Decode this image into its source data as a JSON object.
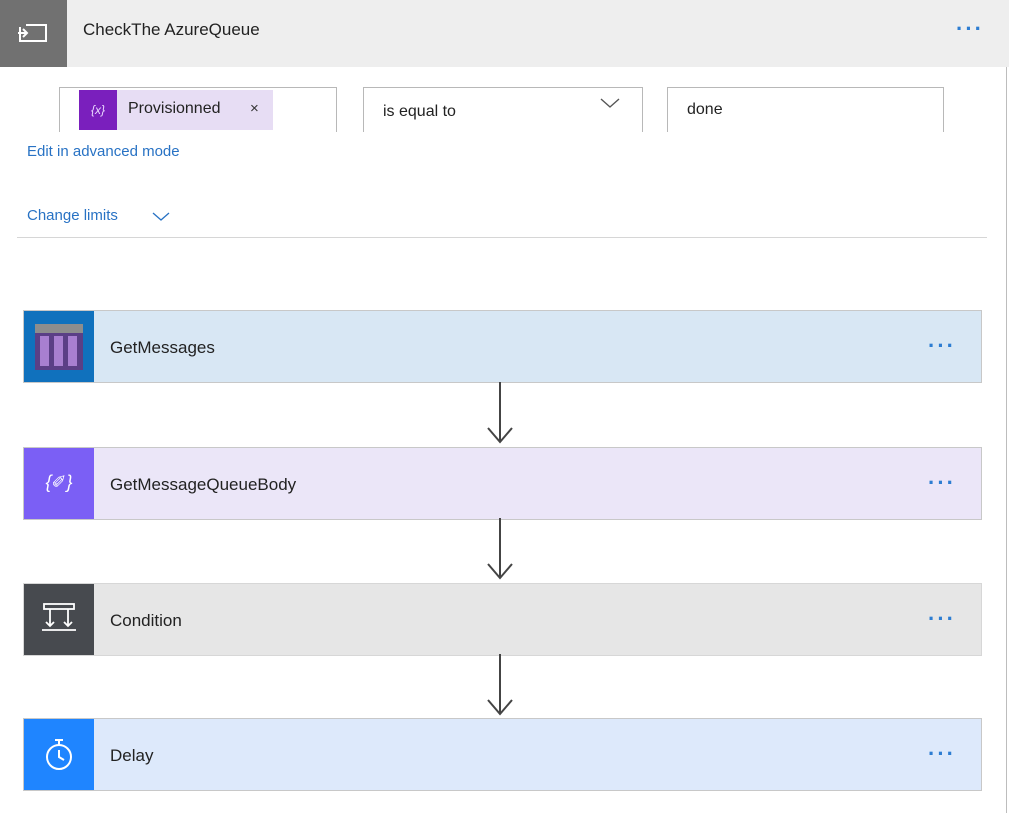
{
  "header": {
    "title": "CheckThe AzureQueue",
    "icon": "loop-until-icon",
    "more_label": "···"
  },
  "condition": {
    "left_token": {
      "label": "Provisionned",
      "icon_label": "{x}",
      "remove_label": "×"
    },
    "operator": {
      "value": "is equal to"
    },
    "right_value": "done"
  },
  "links": {
    "advanced_mode": "Edit in advanced mode",
    "change_limits": "Change limits"
  },
  "actions": [
    {
      "title": "GetMessages",
      "icon": "azure-queue-icon",
      "more_label": "···"
    },
    {
      "title": "GetMessageQueueBody",
      "icon": "variable-icon",
      "icon_label": "{✐}",
      "more_label": "···"
    },
    {
      "title": "Condition",
      "icon": "condition-icon",
      "more_label": "···"
    },
    {
      "title": "Delay",
      "icon": "timer-icon",
      "more_label": "···"
    }
  ],
  "colors": {
    "accent": "#2872c4",
    "token": "#7a1fbd",
    "queue": "#1071bd",
    "variable": "#7b5ff5",
    "condition": "#474a4f",
    "delay": "#1f85ff"
  }
}
